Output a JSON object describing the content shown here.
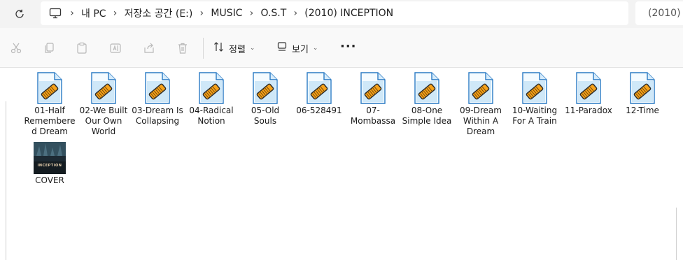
{
  "address_bar": {
    "crumbs": [
      "내 PC",
      "저장소 공간 (E:)",
      "MUSIC",
      "O.S.T",
      "(2010) INCEPTION"
    ],
    "search_text": "(2010) INCEPTION"
  },
  "command_bar": {
    "sort_label": "정렬",
    "view_label": "보기",
    "icons": [
      "cut-icon",
      "copy-icon",
      "paste-icon",
      "rename-icon",
      "share-icon",
      "delete-icon"
    ]
  },
  "files": [
    {
      "name": "01-Half Remembered Dream",
      "icon": "audio-file-icon"
    },
    {
      "name": "02-We Built Our Own World",
      "icon": "audio-file-icon"
    },
    {
      "name": "03-Dream Is Collapsing",
      "icon": "audio-file-icon"
    },
    {
      "name": "04-Radical Notion",
      "icon": "audio-file-icon"
    },
    {
      "name": "05-Old Souls",
      "icon": "audio-file-icon"
    },
    {
      "name": "06-528491",
      "icon": "audio-file-icon"
    },
    {
      "name": "07-Mombassa",
      "icon": "audio-file-icon"
    },
    {
      "name": "08-One Simple Idea",
      "icon": "audio-file-icon"
    },
    {
      "name": "09-Dream Within A Dream",
      "icon": "audio-file-icon"
    },
    {
      "name": "10-Waiting For A Train",
      "icon": "audio-file-icon"
    },
    {
      "name": "11-Paradox",
      "icon": "audio-file-icon"
    },
    {
      "name": "12-Time",
      "icon": "audio-file-icon"
    },
    {
      "name": "COVER",
      "icon": "image-thumbnail-icon"
    }
  ],
  "cover_text": "INCEPTION"
}
